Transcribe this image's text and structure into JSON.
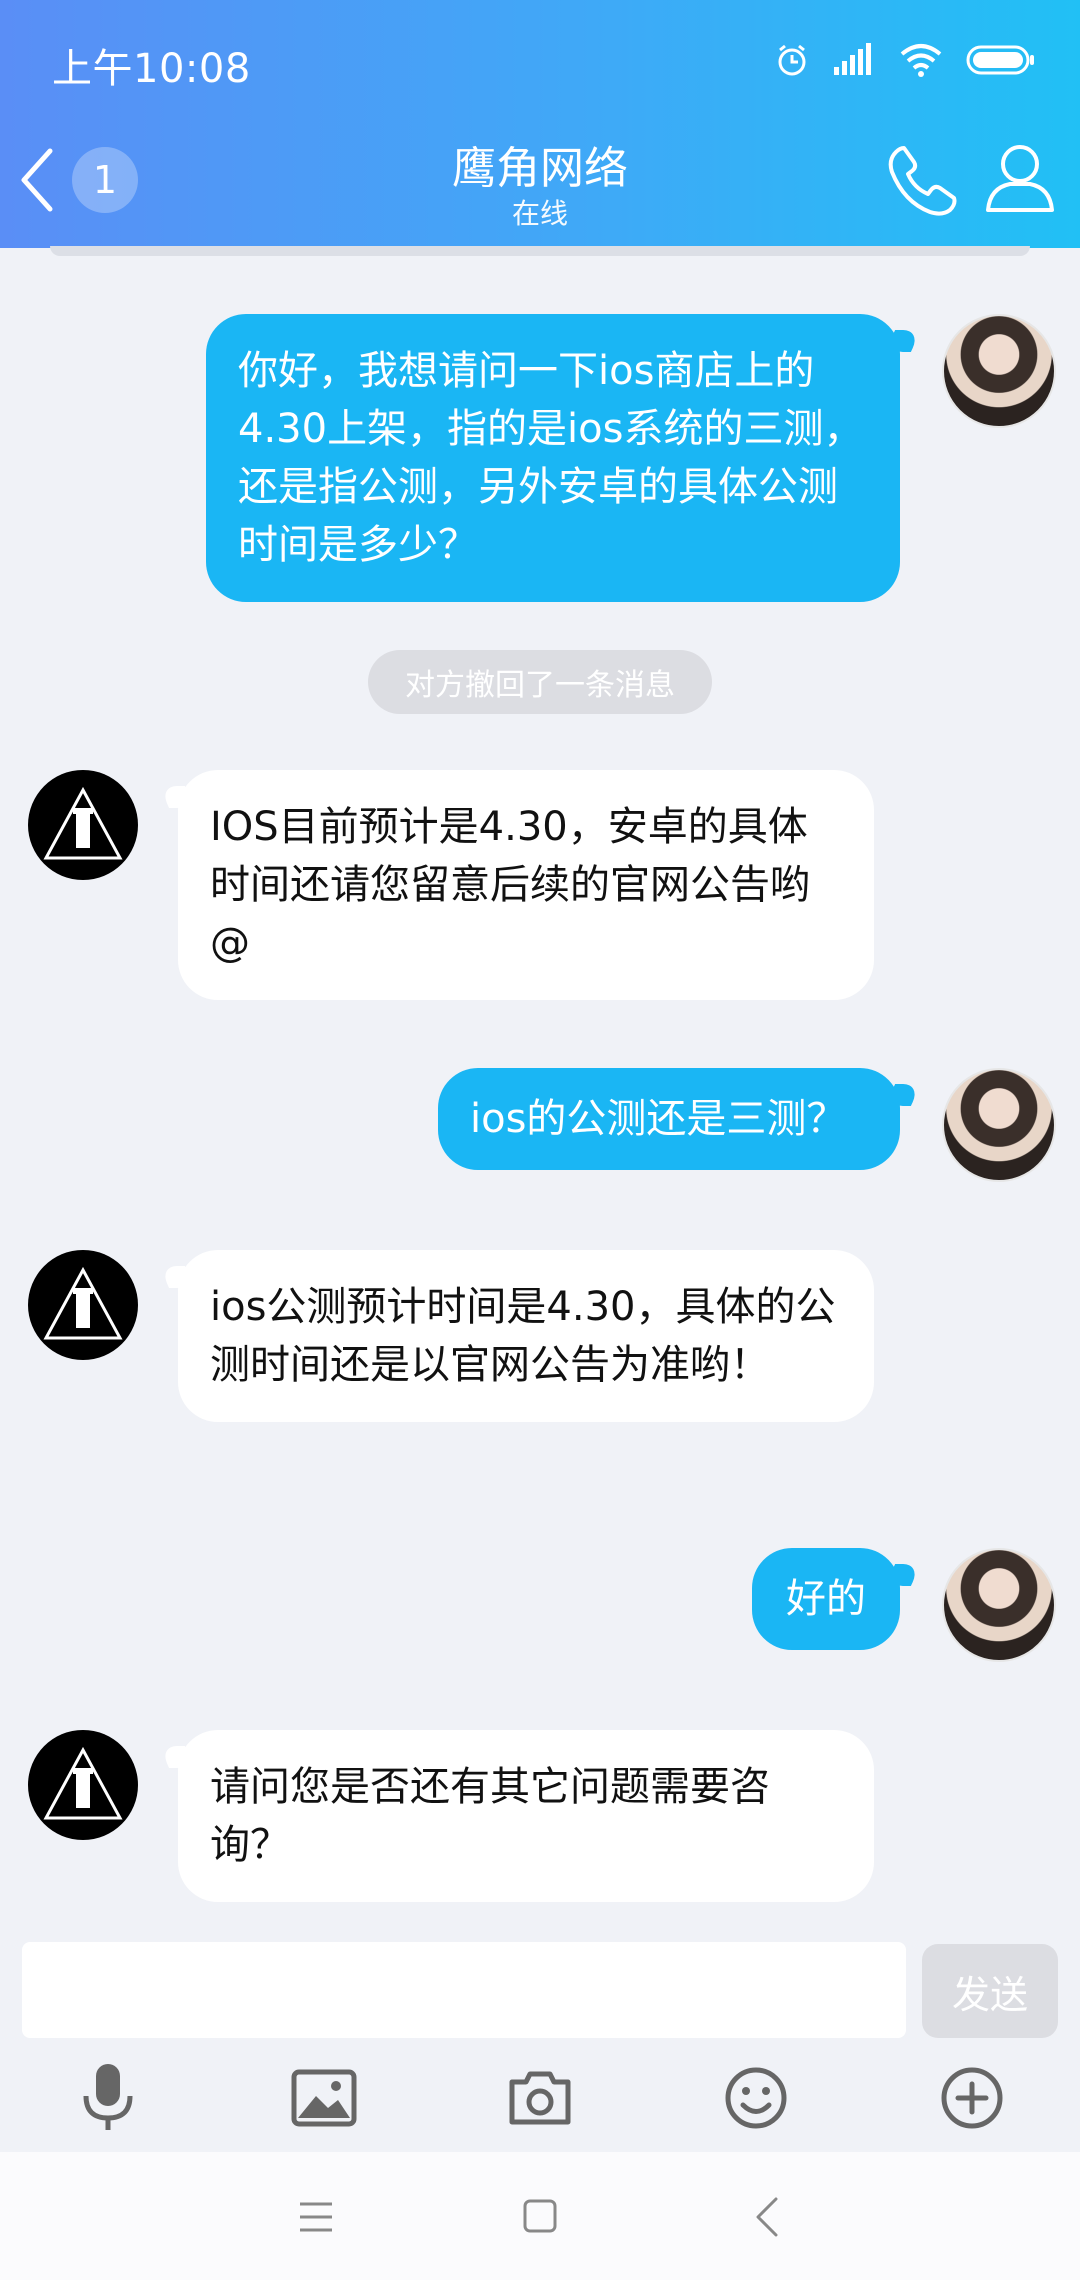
{
  "status_bar": {
    "time": "上午10:08"
  },
  "header": {
    "back_badge": "1",
    "title": "鹰角网络",
    "subtitle": "在线"
  },
  "system_notice": "对方撤回了一条消息",
  "messages": [
    {
      "side": "out",
      "text": "你好，我想请问一下ios商店上的4.30上架，指的是ios系统的三测，还是指公测，另外安卓的具体公测时间是多少？"
    },
    {
      "side": "in",
      "text": "IOS目前预计是4.30，安卓的具体时间还请您留意后续的官网公告哟@"
    },
    {
      "side": "out",
      "text": "ios的公测还是三测？"
    },
    {
      "side": "in",
      "text": "ios公测预计时间是4.30，具体的公测时间还是以官网公告为准哟！"
    },
    {
      "side": "out",
      "text": "好的"
    },
    {
      "side": "in",
      "text": "请问您是否还有其它问题需要咨询？"
    }
  ],
  "composer": {
    "input_value": "",
    "send_label": "发送"
  },
  "icons": {
    "back": "chevron-left-icon",
    "call": "phone-icon",
    "profile": "user-icon",
    "voice": "microphone-icon",
    "image": "image-icon",
    "camera": "camera-icon",
    "emoji": "emoji-icon",
    "more": "plus-circle-icon"
  },
  "colors": {
    "header_start": "#5a8ef6",
    "header_end": "#21c0f5",
    "outgoing_bubble": "#1ab6f4",
    "incoming_bubble": "#ffffff",
    "background": "#f0f2f7"
  }
}
